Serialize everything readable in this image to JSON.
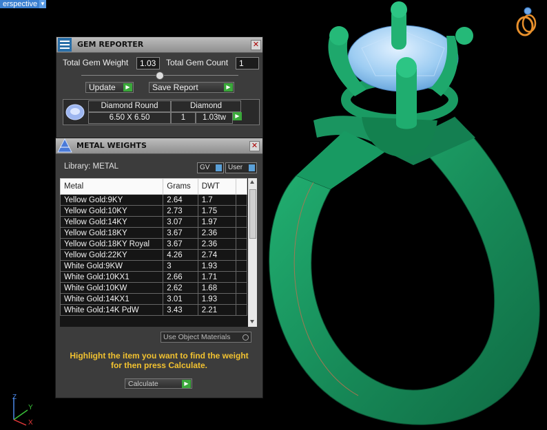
{
  "viewport": {
    "label": "erspective",
    "arrow": "▼"
  },
  "gem_reporter": {
    "title": "GEM REPORTER",
    "close": "✕",
    "total_weight_label": "Total Gem Weight",
    "total_weight_value": "1.03",
    "total_count_label": "Total Gem Count",
    "total_count_value": "1",
    "update_label": "Update",
    "save_report_label": "Save Report",
    "gem": {
      "cut": "Diamond Round",
      "size": "6.50 X 6.50",
      "material": "Diamond",
      "count": "1",
      "weight": "1.03tw"
    }
  },
  "metal_weights": {
    "title": "METAL WEIGHTS",
    "close": "✕",
    "library_label": "Library: METAL",
    "toggle_gv": "GV",
    "toggle_user": "User",
    "columns": [
      "Metal",
      "Grams",
      "DWT"
    ],
    "rows": [
      {
        "metal": "Yellow Gold:9KY",
        "grams": "2.64",
        "dwt": "1.7"
      },
      {
        "metal": "Yellow Gold:10KY",
        "grams": "2.73",
        "dwt": "1.75"
      },
      {
        "metal": "Yellow Gold:14KY",
        "grams": "3.07",
        "dwt": "1.97"
      },
      {
        "metal": "Yellow Gold:18KY",
        "grams": "3.67",
        "dwt": "2.36"
      },
      {
        "metal": "Yellow Gold:18KY Royal",
        "grams": "3.67",
        "dwt": "2.36"
      },
      {
        "metal": "Yellow Gold:22KY",
        "grams": "4.26",
        "dwt": "2.74"
      },
      {
        "metal": "White Gold:9KW",
        "grams": "3",
        "dwt": "1.93"
      },
      {
        "metal": "White Gold:10KX1",
        "grams": "2.66",
        "dwt": "1.71"
      },
      {
        "metal": "White Gold:10KW",
        "grams": "2.62",
        "dwt": "1.68"
      },
      {
        "metal": "White Gold:14KX1",
        "grams": "3.01",
        "dwt": "1.93"
      },
      {
        "metal": "White Gold:14K PdW",
        "grams": "3.43",
        "dwt": "2.21"
      }
    ],
    "use_object_materials": "Use Object Materials",
    "hint": "Highlight the item you want to find the weight for then press Calculate.",
    "calculate_label": "Calculate"
  },
  "axes": {
    "z": "Z",
    "y": "Y",
    "x": "X"
  },
  "colors": {
    "ring": "#1f9e67",
    "gem": "#9cccf2",
    "hint": "#f2c230",
    "accent": "#3aa83a"
  }
}
